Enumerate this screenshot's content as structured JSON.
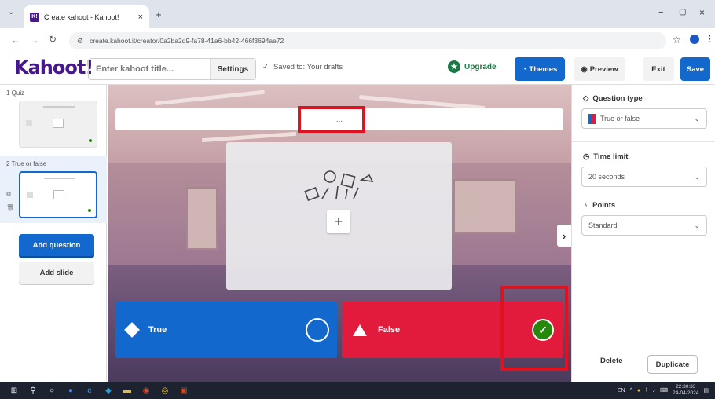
{
  "browser": {
    "tab_title": "Create kahoot - Kahoot!",
    "tab_favicon": "K!",
    "tab_close": "×",
    "new_tab": "+",
    "url": "create.kahoot.it/creator/0a2ba2d9-fa78-41a6-bb42-466f3694ae72",
    "window_controls": [
      "−",
      "▢",
      "×"
    ]
  },
  "header": {
    "logo": "Kahoot!",
    "title_placeholder": "Enter kahoot title...",
    "settings_label": "Settings",
    "saved_status": "Saved to: Your drafts",
    "upgrade_label": "Upgrade",
    "themes_label": "Themes",
    "preview_label": "Preview",
    "exit_label": "Exit",
    "save_label": "Save"
  },
  "sidebar": {
    "slides": [
      {
        "label": "1  Quiz"
      },
      {
        "label": "2  True or false"
      }
    ],
    "add_question_label": "Add question",
    "add_slide_label": "Add slide"
  },
  "editor": {
    "question_placeholder": "...",
    "add_media": "+",
    "next_arrow": "›",
    "answers": [
      {
        "label": "True",
        "color": "#1368ce",
        "correct": false
      },
      {
        "label": "False",
        "color": "#e21b3c",
        "correct": true
      }
    ]
  },
  "settings_panel": {
    "question_type_heading": "Question type",
    "question_type_value": "True or false",
    "time_limit_heading": "Time limit",
    "time_limit_value": "20 seconds",
    "points_heading": "Points",
    "points_value": "Standard",
    "delete_label": "Delete",
    "duplicate_label": "Duplicate"
  },
  "taskbar": {
    "tray_lang": "EN",
    "time": "22:30:33",
    "date": "24-04-2024"
  },
  "colors": {
    "kahoot_purple": "#46178f",
    "primary_blue": "#1368ce",
    "answer_red": "#e21b3c",
    "correct_green": "#26890c",
    "highlight_red": "#e0121f"
  }
}
